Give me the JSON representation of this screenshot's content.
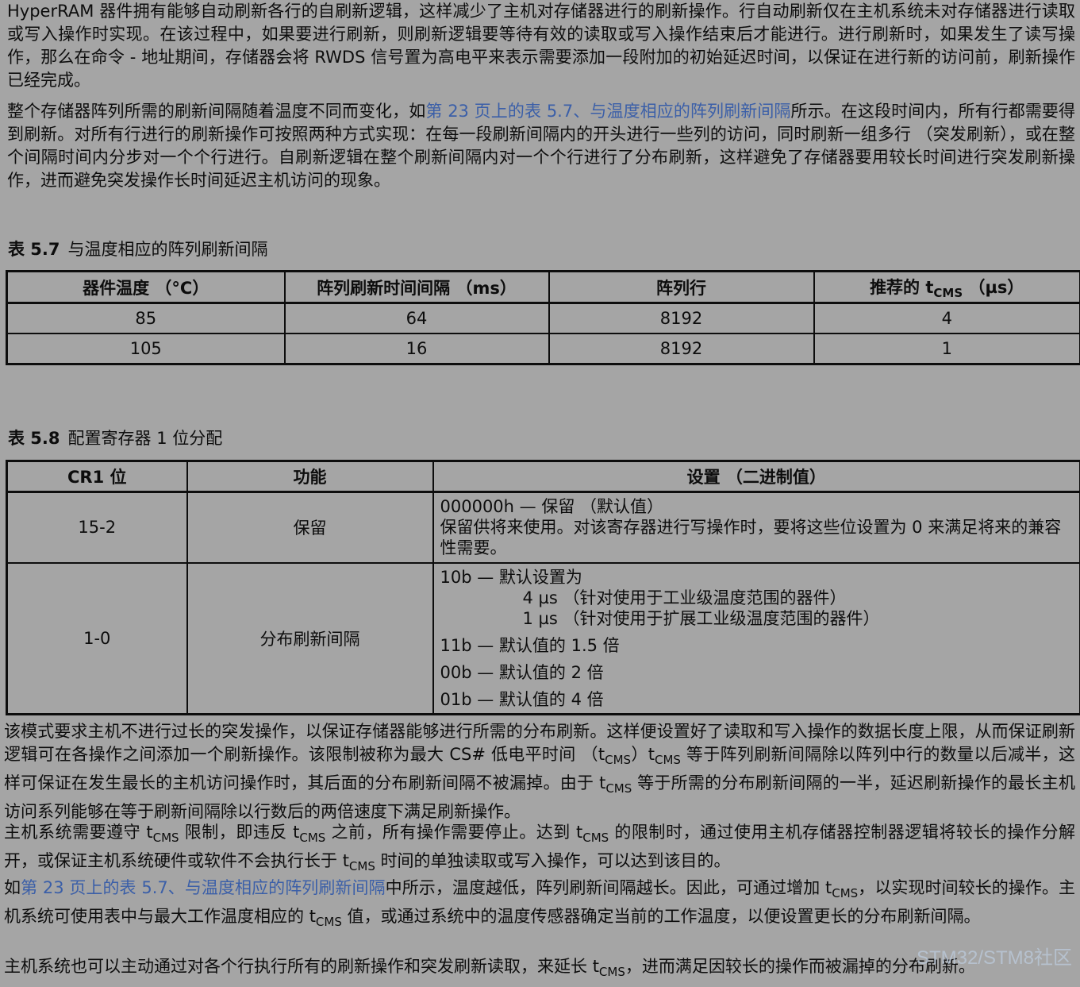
{
  "para1": "HyperRAM 器件拥有能够自动刷新各行的自刷新逻辑，这样减少了主机对存储器进行的刷新操作。行自动刷新仅在主机系统未对存储器进行读取或写入操作时实现。在该过程中，如果要进行刷新，则刷新逻辑要等待有效的读取或写入操作结束后才能进行。进行刷新时，如果发生了读写操作，那么在命令 - 地址期间，存储器会将 RWDS 信号置为高电平来表示需要添加一段附加的初始延迟时间，以保证在进行新的访问前，刷新操作已经完成。",
  "para2": {
    "before": "整个存储器阵列所需的刷新间隔随着温度不同而变化，如",
    "link": "第 23 页上的表 5.7、与温度相应的阵列刷新间隔",
    "after": "所示。在这段时间内，所有行都需要得到刷新。对所有行进行的刷新操作可按照两种方式实现：在每一段刷新间隔内的开头进行一些列的访问，同时刷新一组多行 （突发刷新），或在整个间隔时间内分步对一个个行进行。自刷新逻辑在整个刷新间隔内对一个个行进行了分布刷新，这样避免了存储器要用较长时间进行突发刷新操作，进而避免突发操作长时间延迟主机访问的现象。"
  },
  "table57": {
    "caption_num": "表 5.7",
    "caption_title": "与温度相应的阵列刷新间隔",
    "headers": [
      "器件温度 （°C）",
      "阵列刷新时间间隔 （ms）",
      "阵列行"
    ],
    "h4_pre": "推荐的 t",
    "h4_sub": "CMS",
    "h4_post": " （µs）",
    "rows": [
      [
        "85",
        "64",
        "8192",
        "4"
      ],
      [
        "105",
        "16",
        "8192",
        "1"
      ]
    ]
  },
  "table58": {
    "caption_num": "表 5.8",
    "caption_title": "配置寄存器 1 位分配",
    "headers": [
      "CR1 位",
      "功能",
      "设置 （二进制值）"
    ],
    "rows": [
      {
        "bits": "15-2",
        "func": "保留",
        "lines": [
          "000000h — 保留 （默认值）",
          "保留供将来使用。对该寄存器进行写操作时，要将这些位设置为 0 来满足将来的兼容性需要。"
        ]
      },
      {
        "bits": "1-0",
        "func": "分布刷新间隔",
        "lines": [
          "10b — 默认设置为",
          "4 µs （针对使用于工业级温度范围的器件）",
          "1 µs （针对使用于扩展工业级温度范围的器件）",
          "11b — 默认值的 1.5 倍",
          "00b — 默认值的 2 倍",
          "01b — 默认值的 4 倍"
        ]
      }
    ]
  },
  "para3": {
    "s1": "该模式要求主机不进行过长的突发操作，以保证存储器能够进行所需的分布刷新。这样便设置好了读取和写入操作的数据长度上限，从而保证刷新逻辑可在各操作之间添加一个刷新操作。该限制被称为最大 CS# 低电平时间 （",
    "s2": "）",
    "s3": " 等于阵列刷新间隔除以阵列中行的数量以后减半，这样可保证在发生最长的主机访问操作时，其后面的分布刷新间隔不被漏掉。由于 ",
    "s4": " 等于所需的分布刷新间隔的一半，延迟刷新操作的最长主机访问系列能够在等于刷新间隔除以行数后的两倍速度下满足刷新操作。"
  },
  "para4": {
    "s1": "主机系统需要遵守 ",
    "s2": " 限制，即违反 ",
    "s3": " 之前，所有操作需要停止。达到 ",
    "s4": " 的限制时，通过使用主机存储器控制器逻辑将较长的操作分解开，或保证主机系统硬件或软件不会执行长于 ",
    "s5": " 时间的单独读取或写入操作，可以达到该目的。"
  },
  "para5": {
    "s1": "如",
    "link": "第 23 页上的表 5.7、与温度相应的阵列刷新间隔",
    "s2": "中所示，温度越低，阵列刷新间隔越长。因此，可通过增加 ",
    "s3": "，以实现时间较长的操作。主机系统可使用表中与最大工作温度相应的 ",
    "s4": " 值，或通过系统中的温度传感器确定当前的工作温度，以便设置更长的分布刷新间隔。"
  },
  "para6": {
    "s1": "主机系统也可以主动通过对各个行执行所有的刷新操作和突发刷新读取，来延长 ",
    "s2": "，进而满足因较长的操作而被漏掉的分布刷新。"
  },
  "tcms": {
    "t": "t",
    "sub": "CMS"
  },
  "watermark": "STM32/STM8社区"
}
